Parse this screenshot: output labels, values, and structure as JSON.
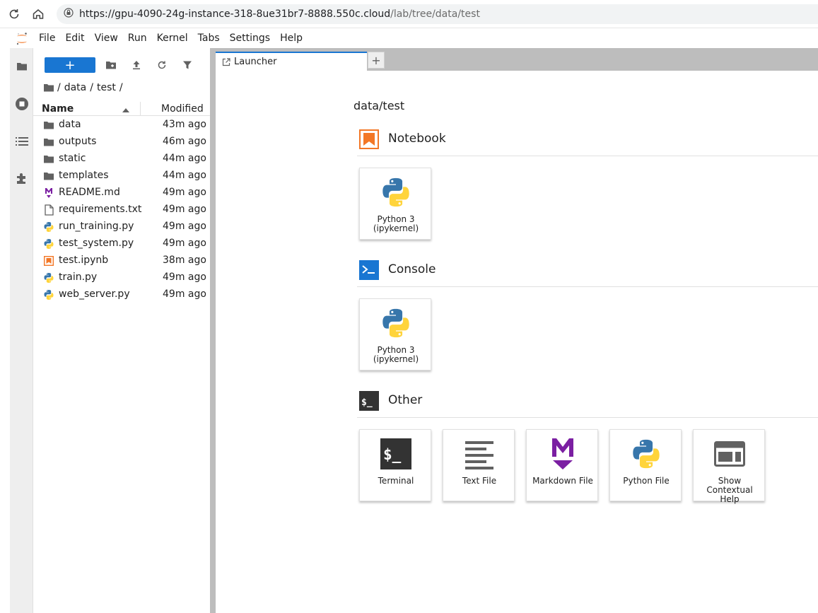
{
  "browser": {
    "url_host": "https://gpu-4090-24g-instance-318-8ue31br7-8888.550c.cloud",
    "url_path": "/lab/tree/data/test"
  },
  "menu": [
    "File",
    "Edit",
    "View",
    "Run",
    "Kernel",
    "Tabs",
    "Settings",
    "Help"
  ],
  "filebrowser": {
    "new_label": "+",
    "breadcrumb": [
      "/",
      "data",
      "/",
      "test",
      "/"
    ],
    "header": {
      "name": "Name",
      "modified": "Modified"
    },
    "files": [
      {
        "name": "data",
        "modified": "43m ago",
        "icon": "folder-icon"
      },
      {
        "name": "outputs",
        "modified": "46m ago",
        "icon": "folder-icon"
      },
      {
        "name": "static",
        "modified": "44m ago",
        "icon": "folder-icon"
      },
      {
        "name": "templates",
        "modified": "44m ago",
        "icon": "folder-icon"
      },
      {
        "name": "README.md",
        "modified": "49m ago",
        "icon": "markdown-icon"
      },
      {
        "name": "requirements.txt",
        "modified": "49m ago",
        "icon": "text-file-icon"
      },
      {
        "name": "run_training.py",
        "modified": "49m ago",
        "icon": "python-icon"
      },
      {
        "name": "test_system.py",
        "modified": "49m ago",
        "icon": "python-icon"
      },
      {
        "name": "test.ipynb",
        "modified": "38m ago",
        "icon": "notebook-icon"
      },
      {
        "name": "train.py",
        "modified": "49m ago",
        "icon": "python-icon"
      },
      {
        "name": "web_server.py",
        "modified": "49m ago",
        "icon": "python-icon"
      }
    ]
  },
  "tabs": [
    {
      "label": "Launcher"
    }
  ],
  "tab_add": "+",
  "launcher": {
    "path": "data/test",
    "sections": {
      "notebook": {
        "title": "Notebook",
        "cards": [
          {
            "label_line1": "Python 3",
            "label_line2": "(ipykernel)"
          }
        ]
      },
      "console": {
        "title": "Console",
        "cards": [
          {
            "label_line1": "Python 3",
            "label_line2": "(ipykernel)"
          }
        ]
      },
      "other": {
        "title": "Other",
        "cards": [
          {
            "label": "Terminal"
          },
          {
            "label": "Text File"
          },
          {
            "label": "Markdown File"
          },
          {
            "label": "Python File"
          },
          {
            "label_line1": "Show",
            "label_line2": "Contextual",
            "label_line3": "Help"
          }
        ]
      }
    }
  },
  "colors": {
    "accent": "#1976d2",
    "notebook_orange": "#f37726",
    "markdown_purple": "#7b1fa2",
    "python_blue": "#3776ab",
    "python_yellow": "#ffd43b"
  }
}
